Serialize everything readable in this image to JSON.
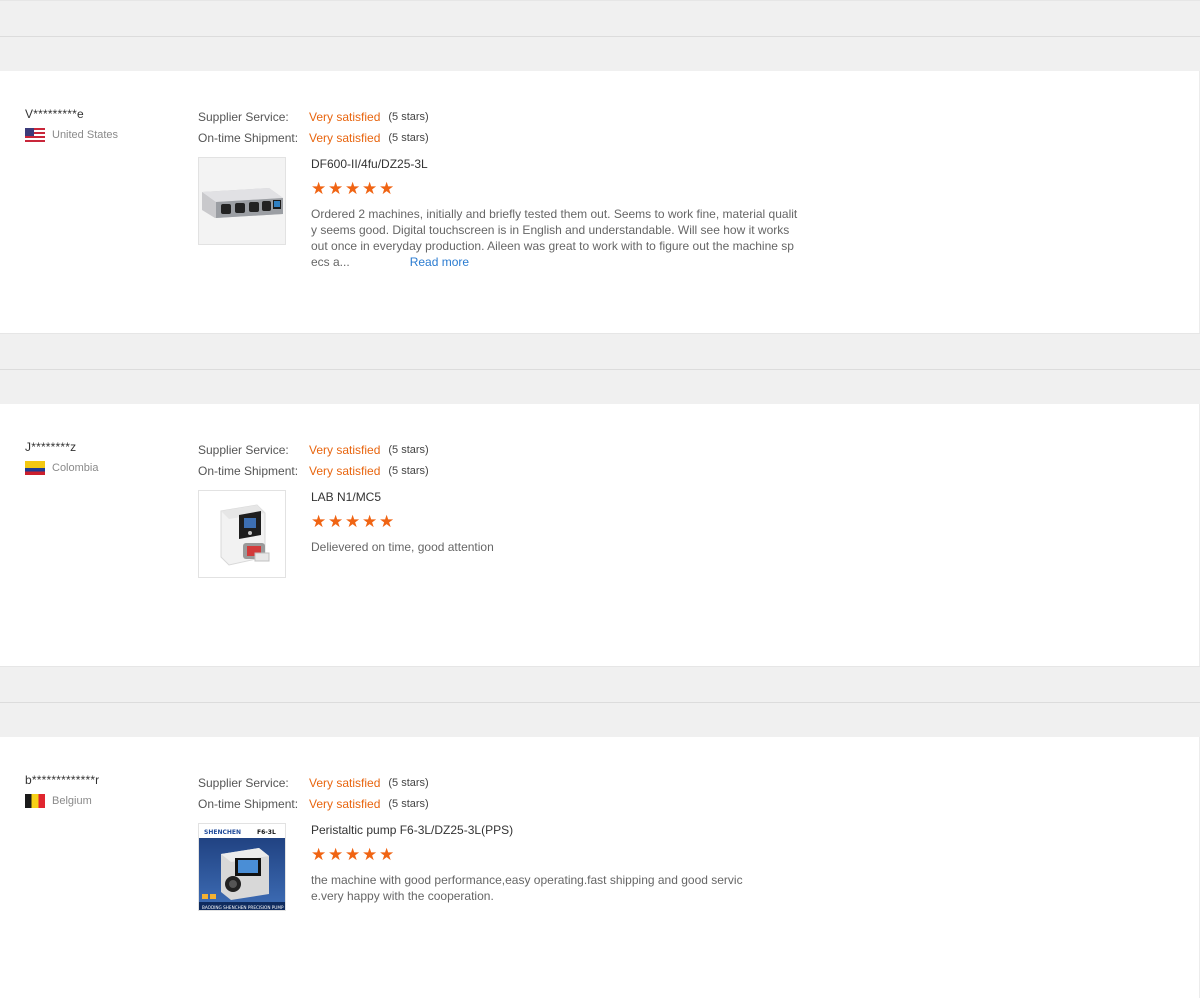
{
  "reviews": [
    {
      "buyer": "V*********e",
      "country": "United States",
      "supplier_service_label": "Supplier Service:",
      "supplier_service_value": "Very satisfied",
      "supplier_service_stars": "(5 stars)",
      "shipment_label": "On-time Shipment:",
      "shipment_value": "Very satisfied",
      "shipment_stars": "(5 stars)",
      "product": "DF600-II/4fu/DZ25-3L",
      "rating": 5,
      "text": "Ordered 2 machines, initially and briefly tested them out. Seems to work fine, material quality seems good. Digital touchscreen is in English and understandable. Will see how it works out once in everyday production. Aileen was great to work with to figure out the machine specs a...",
      "read_more": "Read more"
    },
    {
      "buyer": "J********z",
      "country": "Colombia",
      "supplier_service_label": "Supplier Service:",
      "supplier_service_value": "Very satisfied",
      "supplier_service_stars": "(5 stars)",
      "shipment_label": "On-time Shipment:",
      "shipment_value": "Very satisfied",
      "shipment_stars": "(5 stars)",
      "product": "LAB N1/MC5",
      "rating": 5,
      "text": "Delievered on time, good attention"
    },
    {
      "buyer": "b*************r",
      "country": "Belgium",
      "supplier_service_label": "Supplier Service:",
      "supplier_service_value": "Very satisfied",
      "supplier_service_stars": "(5 stars)",
      "shipment_label": "On-time Shipment:",
      "shipment_value": "Very satisfied",
      "shipment_stars": "(5 stars)",
      "product": "Peristaltic pump F6-3L/DZ25-3L(PPS)",
      "rating": 5,
      "text": "the machine with good performance,easy operating.fast shipping and good service.very happy with the cooperation.",
      "thumb_brand": "SHENCHEN",
      "thumb_model": "F6-3L",
      "thumb_footer": "BAODING SHENCHEN PRECISION PUMP"
    }
  ],
  "colors": {
    "accent": "#e8650f",
    "star": "#f06413",
    "link": "#2a7bd0",
    "divider_bg": "#f0f0f0"
  }
}
